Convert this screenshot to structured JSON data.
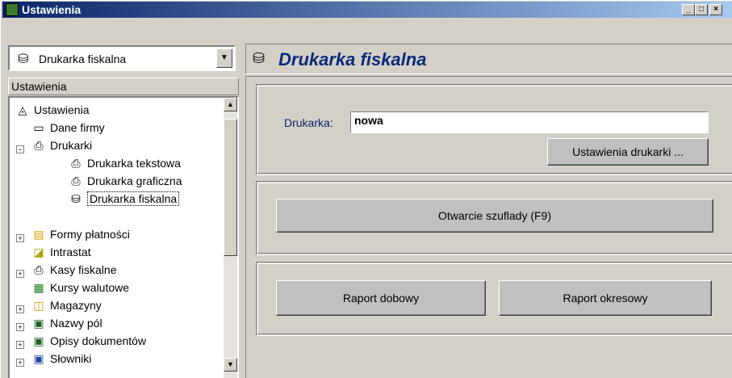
{
  "window": {
    "title": "Ustawienia",
    "controls": [
      "_",
      "□",
      "×"
    ]
  },
  "combo": {
    "value": "Drukarka fiskalna",
    "arrow": "▼"
  },
  "tree": {
    "header": "Ustawienia",
    "scroll_up": "▲",
    "scroll_down": "▼",
    "items": [
      {
        "label": "Ustawienia",
        "icon": "◬"
      },
      {
        "label": "Dane firmy",
        "icon": "▭"
      },
      {
        "label": "Drukarki",
        "icon": "⎙",
        "toggle": "−"
      },
      {
        "label": "Drukarka tekstowa",
        "icon": "⎙"
      },
      {
        "label": "Drukarka graficzna",
        "icon": "⎙"
      },
      {
        "label": "Drukarka fiskalna",
        "icon": "⛁"
      },
      {
        "label": "Formy płatności",
        "icon": "▤",
        "toggle": "+"
      },
      {
        "label": "Intrastat",
        "icon": "◪"
      },
      {
        "label": "Kasy fiskalne",
        "icon": "⎙",
        "toggle": "+"
      },
      {
        "label": "Kursy walutowe",
        "icon": "▦"
      },
      {
        "label": "Magazyny",
        "icon": "◫",
        "toggle": "+"
      },
      {
        "label": "Nazwy pól",
        "icon": "▣",
        "toggle": "+"
      },
      {
        "label": "Opisy dokumentów",
        "icon": "▣",
        "toggle": "+"
      },
      {
        "label": "Słowniki",
        "icon": "▣",
        "toggle": "+"
      }
    ]
  },
  "main": {
    "title": "Drukarka fiskalna",
    "printer_label": "Drukarka:",
    "printer_value": "nowa",
    "printer_settings_button": "Ustawienia drukarki ...",
    "open_drawer_button": "Otwarcie szuflady (F9)",
    "daily_report_button": "Raport dobowy",
    "period_report_button": "Raport okresowy"
  }
}
